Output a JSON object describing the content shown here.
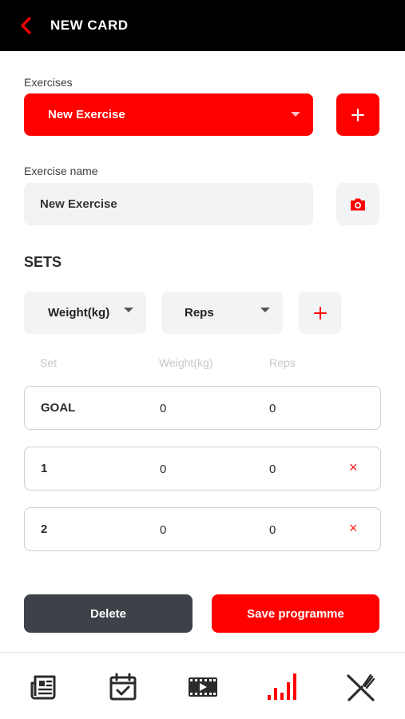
{
  "header": {
    "title": "NEW CARD",
    "back_icon": "chevron-left-icon",
    "accent": "#ff0000"
  },
  "exercises": {
    "label": "Exercises",
    "selected": "New Exercise",
    "add_icon": "plus-icon"
  },
  "exercise_name": {
    "label": "Exercise name",
    "value": "New Exercise",
    "camera_icon": "camera-icon"
  },
  "sets": {
    "title": "SETS",
    "selectors": [
      "Weight(kg)",
      "Reps"
    ],
    "add_icon": "plus-icon",
    "columns": [
      "Set",
      "Weight(kg)",
      "Reps"
    ],
    "rows": [
      {
        "set": "GOAL",
        "weight": "0",
        "reps": "0",
        "deletable": false
      },
      {
        "set": "1",
        "weight": "0",
        "reps": "0",
        "deletable": true,
        "delete_glyph": "×"
      },
      {
        "set": "2",
        "weight": "0",
        "reps": "0",
        "deletable": true,
        "delete_glyph": "×"
      }
    ]
  },
  "actions": {
    "delete_label": "Delete",
    "save_label": "Save programme"
  },
  "tabbar": {
    "items": [
      "news-icon",
      "calendar-check-icon",
      "video-icon",
      "stats-icon",
      "food-icon"
    ],
    "active": "stats-icon"
  }
}
